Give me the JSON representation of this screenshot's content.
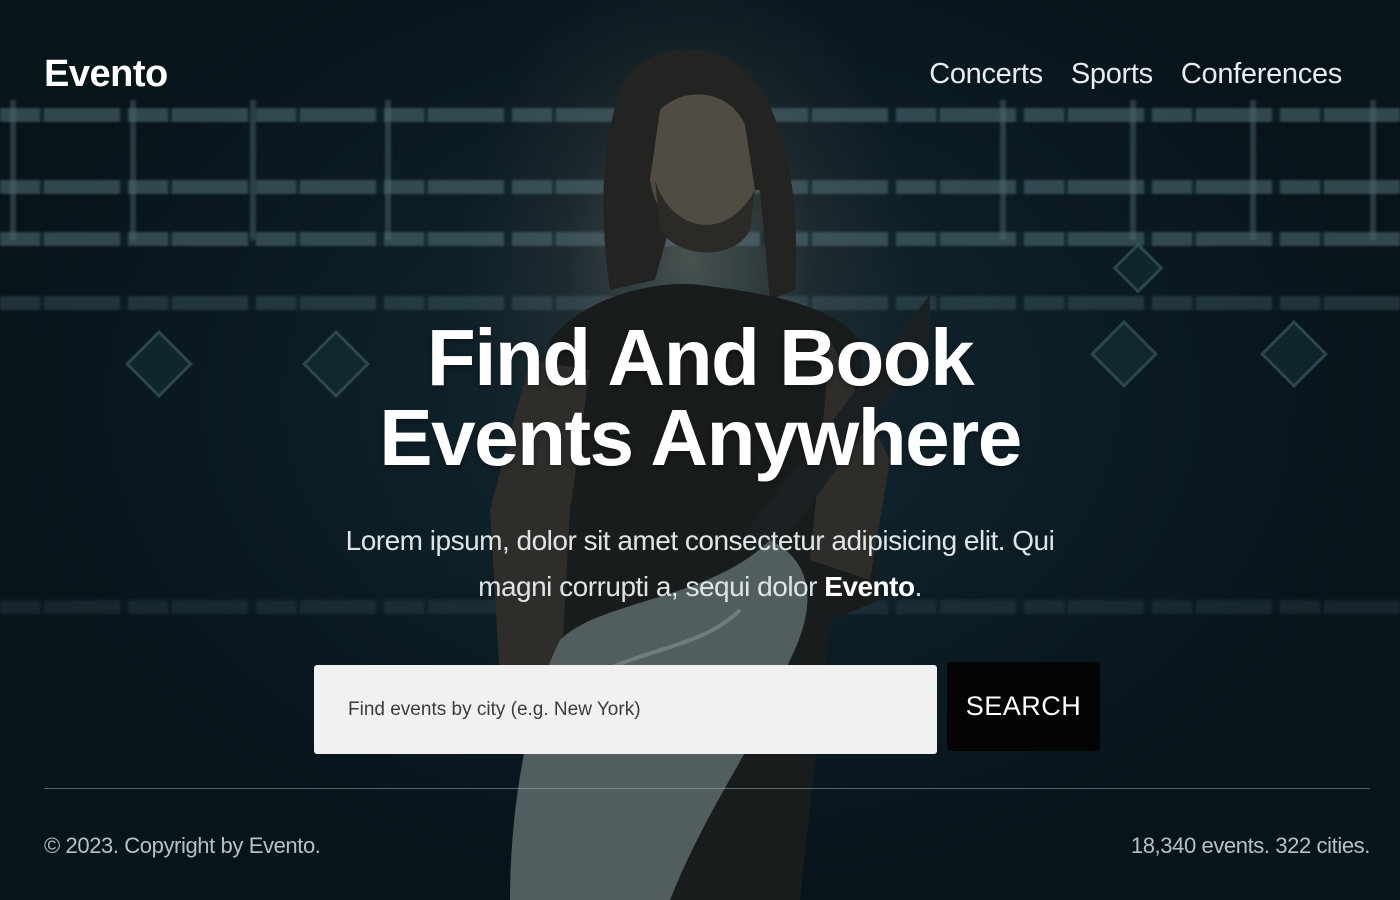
{
  "brand": {
    "logo_text": "Evento"
  },
  "nav": {
    "items": [
      {
        "label": "Concerts"
      },
      {
        "label": "Sports"
      },
      {
        "label": "Conferences"
      }
    ]
  },
  "hero": {
    "title_line1": "Find And Book",
    "title_line2": "Events Anywhere",
    "description_main": "Lorem ipsum, dolor sit amet consectetur adipisicing elit. Qui magni corrupti a, sequi dolor ",
    "description_brand": "Evento",
    "description_end": "."
  },
  "search": {
    "placeholder": "Find events by city (e.g. New York)",
    "value": "",
    "button_label": "SEARCH"
  },
  "footer": {
    "copyright": "© 2023. Copyright by Evento.",
    "stats": "18,340 events. 322 cities."
  },
  "colors": {
    "background": "#0b1820",
    "search_button": "#040404",
    "search_input": "#f1f1f1",
    "text": "#ffffff"
  }
}
